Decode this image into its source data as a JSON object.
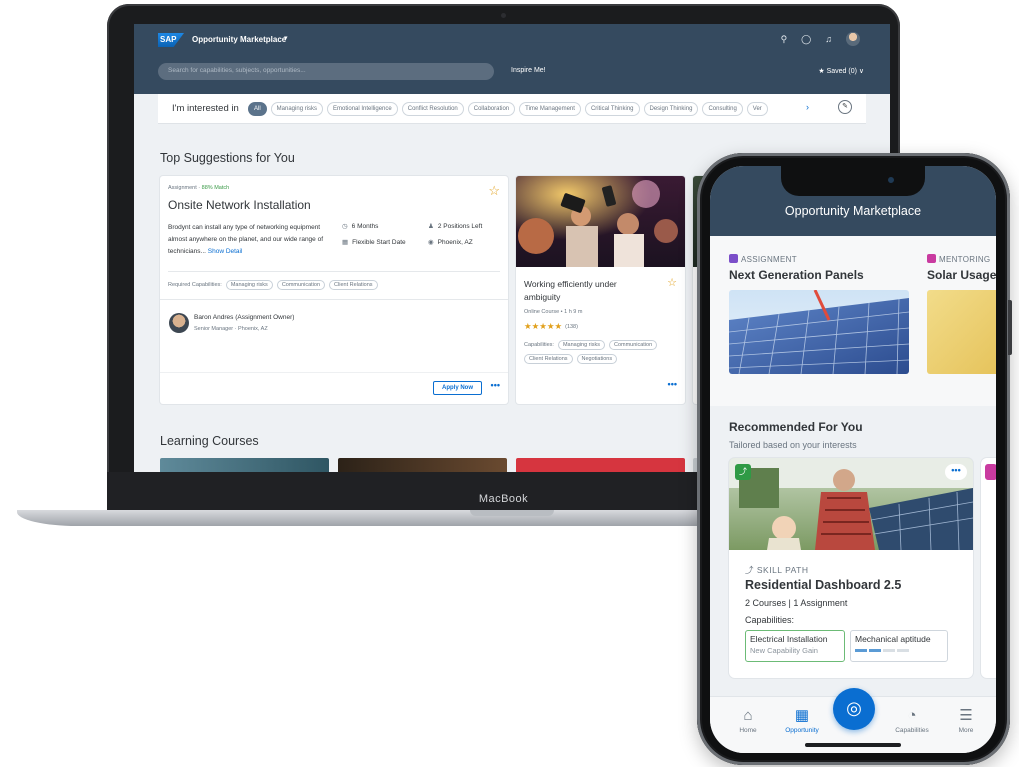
{
  "laptop": {
    "brand": "MacBook",
    "shell": {
      "logo": "SAP",
      "app_title": "Opportunity Marketplace",
      "caret": "▾",
      "search_placeholder": "Search for capabilities, subjects, opportunities...",
      "inspire": "Inspire Me!",
      "saved": "★ Saved (0) ∨",
      "icons": [
        "search-icon",
        "help-icon",
        "notification-icon",
        "avatar"
      ]
    },
    "filters": {
      "label": "I'm interested in",
      "chips": [
        "All",
        "Managing risks",
        "Emotional Intelligence",
        "Conflict Resolution",
        "Collaboration",
        "Time Management",
        "Critical Thinking",
        "Design Thinking",
        "Consulting",
        "Ver"
      ],
      "next": "›",
      "edit": "✎"
    },
    "top_suggestions": {
      "title": "Top Suggestions for You",
      "assignment": {
        "type": "Assignment",
        "match": "88% Match",
        "title": "Onsite Network Installation",
        "description": "Brodynt can install any type of networking equipment almost anywhere on the planet, and our wide range of technicians...",
        "show_detail": "Show Detail",
        "duration": "6 Months",
        "positions": "2 Positions Left",
        "start": "Flexible Start Date",
        "location": "Phoenix, AZ",
        "required_label": "Required Capabilities:",
        "required": [
          "Managing risks",
          "Communication",
          "Client Relations"
        ],
        "owner_name": "Baron Andres (Assignment Owner)",
        "owner_role": "Senior Manager",
        "owner_location": "Phoenix, AZ",
        "apply": "Apply Now",
        "more": "•••"
      },
      "course": {
        "title": "Working efficiently under ambiguity",
        "meta": "Online Course • 1 h 9 m",
        "stars": "★★★★★",
        "rating_count": "(138)",
        "caps_label": "Capabilities:",
        "caps": [
          "Managing risks",
          "Communication",
          "Client Relations",
          "Negotiations"
        ],
        "more": "•••"
      }
    },
    "learning_courses": {
      "title": "Learning Courses"
    }
  },
  "phone": {
    "title": "Opportunity Marketplace",
    "top_cards": [
      {
        "type": "ASSIGNMENT",
        "title": "Next Generation Panels",
        "color": "#7b4fc9"
      },
      {
        "type": "MENTORING",
        "title": "Solar Usage",
        "color": "#c93ba0"
      }
    ],
    "recommended": {
      "title": "Recommended For You",
      "subtitle": "Tailored based on your interests",
      "card": {
        "type": "SKILL PATH",
        "title": "Residential Dashboard 2.5",
        "subtitle": "2 Courses | 1 Assignment",
        "caps_label": "Capabilities:",
        "caps": [
          {
            "name": "Electrical Installation",
            "sub": "New Capability Gain"
          },
          {
            "name": "Mechanical aptitude",
            "progress": 0.5
          }
        ],
        "more": "•••"
      }
    },
    "tabs": [
      {
        "label": "Home",
        "icon": "⌂"
      },
      {
        "label": "Opportunity",
        "icon": "▦",
        "active": true
      },
      {
        "label": "Capabilities",
        "icon": "◔"
      },
      {
        "label": "More",
        "icon": "☰"
      }
    ],
    "fab_icon": "◎"
  }
}
